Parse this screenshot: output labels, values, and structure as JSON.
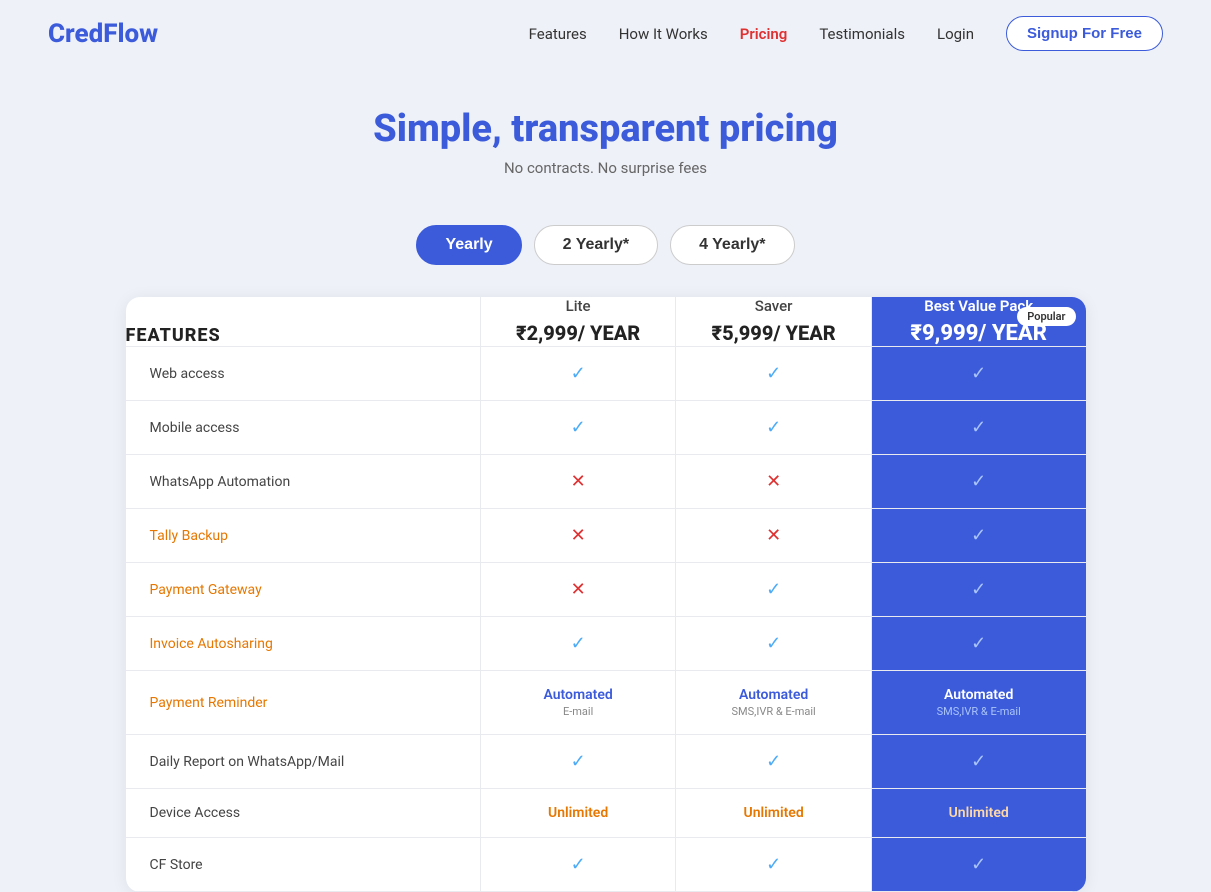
{
  "brand": {
    "name": "CredFlow"
  },
  "nav": {
    "links": [
      {
        "label": "Features",
        "active": false
      },
      {
        "label": "How It Works",
        "active": false
      },
      {
        "label": "Pricing",
        "active": true
      },
      {
        "label": "Testimonials",
        "active": false
      },
      {
        "label": "Login",
        "active": false
      }
    ],
    "signup_label": "Signup For Free"
  },
  "hero": {
    "title": "Simple, transparent pricing",
    "subtitle": "No contracts. No surprise fees"
  },
  "toggle": {
    "options": [
      {
        "label": "Yearly",
        "active": true
      },
      {
        "label": "2 Yearly*",
        "active": false
      },
      {
        "label": "4 Yearly*",
        "active": false
      }
    ]
  },
  "table": {
    "features_header": "FEATURES",
    "popular_badge": "Popular",
    "plans": [
      {
        "name": "Lite",
        "price": "₹2,999/ YEAR",
        "is_best": false
      },
      {
        "name": "Saver",
        "price": "₹5,999/ YEAR",
        "is_best": false
      },
      {
        "name": "Best Value Pack",
        "price": "₹9,999/ YEAR",
        "is_best": true
      }
    ],
    "rows": [
      {
        "feature": "Web access",
        "highlighted": false,
        "lite": "check",
        "saver": "check",
        "best": "check"
      },
      {
        "feature": "Mobile access",
        "highlighted": false,
        "lite": "check",
        "saver": "check",
        "best": "check"
      },
      {
        "feature": "WhatsApp Automation",
        "highlighted": false,
        "lite": "cross",
        "saver": "cross",
        "best": "check"
      },
      {
        "feature": "Tally Backup",
        "highlighted": true,
        "lite": "cross",
        "saver": "cross",
        "best": "check"
      },
      {
        "feature": "Payment Gateway",
        "highlighted": true,
        "lite": "cross",
        "saver": "check",
        "best": "check"
      },
      {
        "feature": "Invoice Autosharing",
        "highlighted": true,
        "lite": "check",
        "saver": "check",
        "best": "check"
      },
      {
        "feature": "Payment Reminder",
        "highlighted": true,
        "lite_text": "Automated",
        "lite_sub": "E-mail",
        "saver_text": "Automated",
        "saver_sub": "SMS,IVR & E-mail",
        "best_text": "Automated",
        "best_sub": "SMS,IVR & E-mail"
      },
      {
        "feature": "Daily Report on WhatsApp/Mail",
        "highlighted": false,
        "lite": "check",
        "saver": "check",
        "best": "check"
      },
      {
        "feature": "Device Access",
        "highlighted": false,
        "lite": "unlimited",
        "saver": "unlimited",
        "best": "unlimited"
      },
      {
        "feature": "CF Store",
        "highlighted": false,
        "lite": "check",
        "saver": "check",
        "best": "check"
      }
    ]
  }
}
